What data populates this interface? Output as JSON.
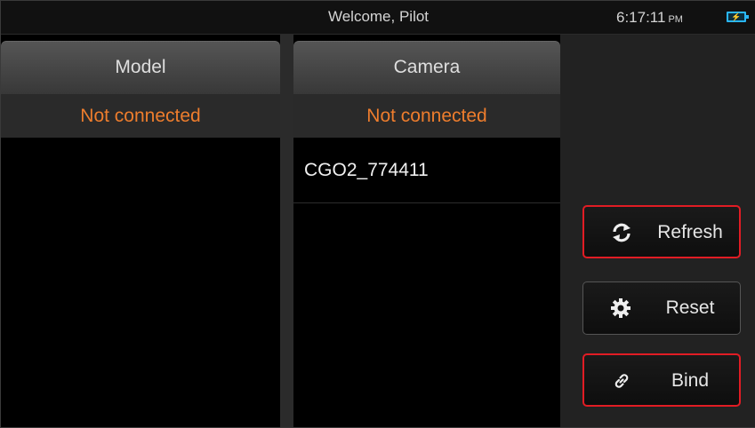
{
  "header": {
    "welcome": "Welcome, Pilot",
    "time": "6:17:11",
    "ampm": "PM",
    "battery_icon": "battery-charging-icon"
  },
  "model_panel": {
    "title": "Model",
    "status": "Not connected"
  },
  "camera_panel": {
    "title": "Camera",
    "status": "Not connected",
    "items": [
      "CGO2_774411"
    ]
  },
  "actions": {
    "refresh": {
      "label": "Refresh",
      "icon": "refresh-icon"
    },
    "reset": {
      "label": "Reset",
      "icon": "gear-icon"
    },
    "bind": {
      "label": "Bind",
      "icon": "link-icon"
    }
  },
  "colors": {
    "status_text": "#ee7d2d",
    "highlight_border": "#e11c24",
    "battery": "#29b6f6"
  }
}
